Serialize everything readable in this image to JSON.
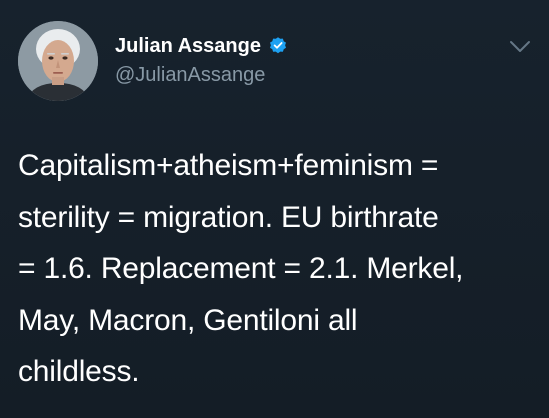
{
  "author": {
    "display_name": "Julian Assange",
    "handle": "@JulianAssange",
    "verified": true,
    "verified_color": "#1da1f2",
    "avatar_icon": "profile-photo"
  },
  "menu": {
    "icon": "chevron-down-icon"
  },
  "tweet": {
    "lines": [
      "Capitalism+atheism+feminism =",
      "sterility = migration. EU birthrate",
      "= 1.6. Replacement = 2.1. Merkel,",
      "May, Macron, Gentiloni all",
      "childless."
    ]
  },
  "colors": {
    "background": "#141d26",
    "text_primary": "#ffffff",
    "text_secondary": "#8899a6"
  }
}
